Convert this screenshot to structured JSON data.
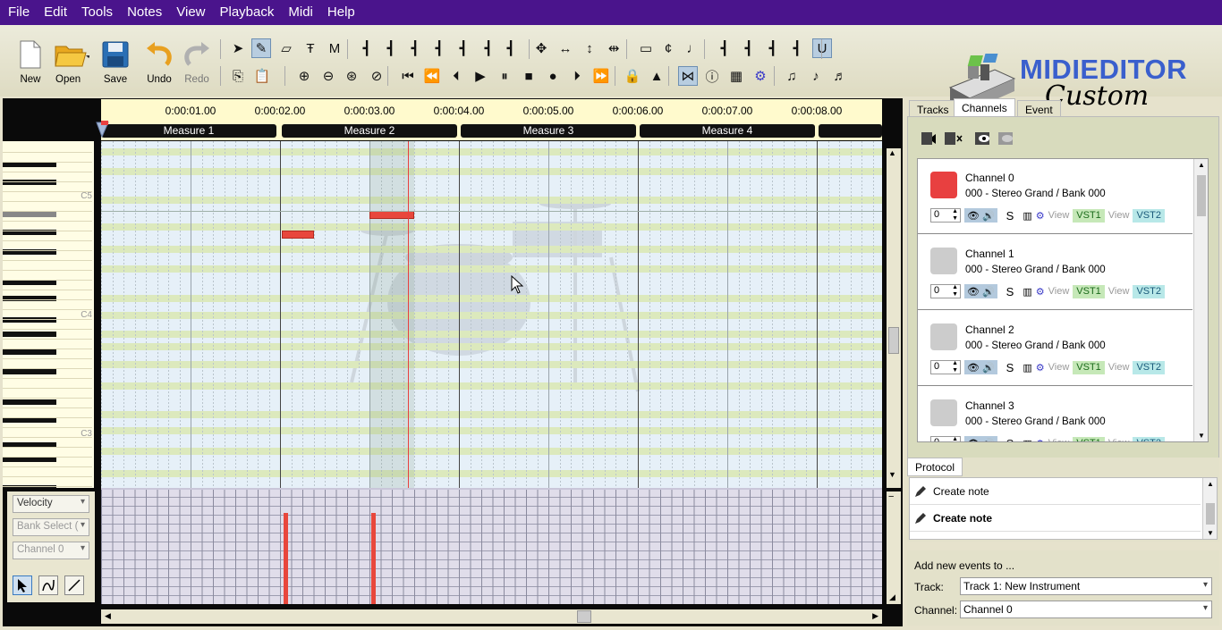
{
  "menu": [
    "File",
    "Edit",
    "Tools",
    "Notes",
    "View",
    "Playback",
    "Midi",
    "Help"
  ],
  "toolbar": {
    "new_label": "New",
    "open_label": "Open",
    "save_label": "Save",
    "undo_label": "Undo",
    "redo_label": "Redo"
  },
  "logo": {
    "line1": "MIDIEDITOR",
    "line2": "Custom"
  },
  "timeline": {
    "times": [
      "0:00:01.00",
      "0:00:02.00",
      "0:00:03.00",
      "0:00:04.00",
      "0:00:05.00",
      "0:00:06.00",
      "0:00:07.00",
      "0:00:08.00"
    ],
    "measures": [
      "Measure 1",
      "Measure 2",
      "Measure 3",
      "Measure 4"
    ]
  },
  "piano": {
    "labels": [
      "C5",
      "C4",
      "C3"
    ]
  },
  "velocity_panel": {
    "mode": "Velocity",
    "control": "Bank Select (",
    "channel": "Channel 0"
  },
  "tabs": [
    "Tracks",
    "Channels",
    "Event"
  ],
  "channels": [
    {
      "name": "Channel 0",
      "instrument": "000 - Stereo Grand / Bank 000",
      "color": "#e84040",
      "value": "0"
    },
    {
      "name": "Channel 1",
      "instrument": "000 - Stereo Grand / Bank 000",
      "color": "#cccccc",
      "value": "0"
    },
    {
      "name": "Channel 2",
      "instrument": "000 - Stereo Grand / Bank 000",
      "color": "#cccccc",
      "value": "0"
    },
    {
      "name": "Channel 3",
      "instrument": "000 - Stereo Grand / Bank 000",
      "color": "#cccccc",
      "value": "0"
    }
  ],
  "channel_controls": {
    "solo": "S",
    "view": "View",
    "vst1": "VST1",
    "vst2": "VST2"
  },
  "protocol": {
    "title": "Protocol",
    "items": [
      "Create note",
      "Create note"
    ]
  },
  "add_events": {
    "title": "Add new events to ...",
    "track_label": "Track:",
    "track_value": "Track 1: New Instrument",
    "channel_label": "Channel:",
    "channel_value": "Channel 0"
  }
}
